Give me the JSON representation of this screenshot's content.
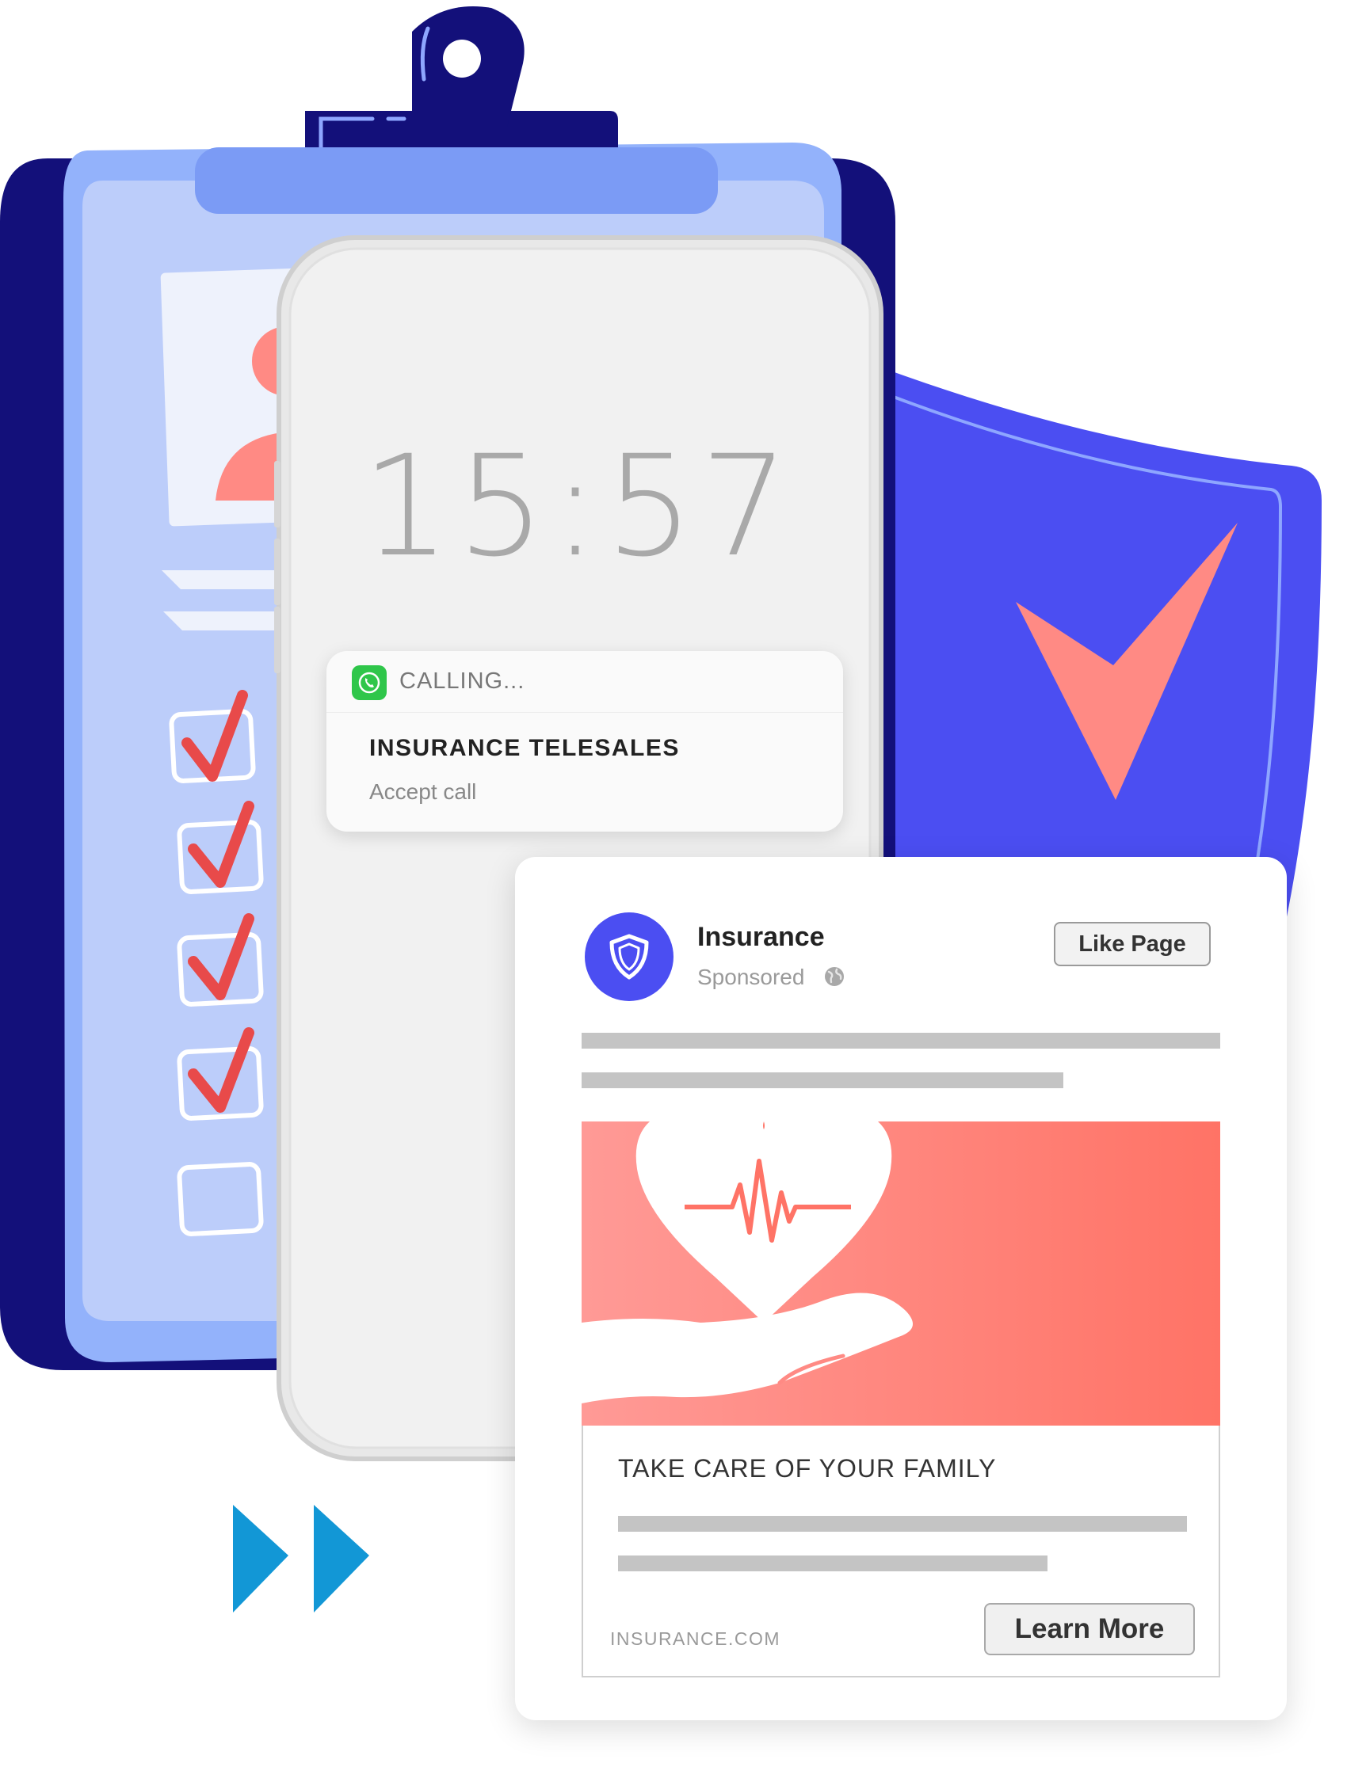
{
  "phone": {
    "time": "15:57",
    "notification": {
      "app_label": "CALLING...",
      "icon": "phone-icon",
      "title": "INSURANCE TELESALES",
      "action": "Accept call"
    }
  },
  "ad": {
    "page_name": "Insurance",
    "sponsored_label": "Sponsored",
    "like_button_label": "Like Page",
    "headline": "TAKE CARE OF YOUR FAMILY",
    "domain": "INSURANCE.COM",
    "cta_label": "Learn More",
    "avatar_icon": "shield-icon",
    "image_icons": [
      "heart-pulse-icon",
      "hand-icon"
    ]
  },
  "clipboard": {
    "checkbox_states": [
      true,
      true,
      true,
      true,
      false
    ],
    "icon": "person-icon"
  },
  "colors": {
    "clipboard_dark": "#13107a",
    "clipboard_light": "#bccdfa",
    "shield": "#4b4ef2",
    "accent_coral": "#ff8a84",
    "check_red": "#e84a4a",
    "play_blue": "#1297d6"
  }
}
